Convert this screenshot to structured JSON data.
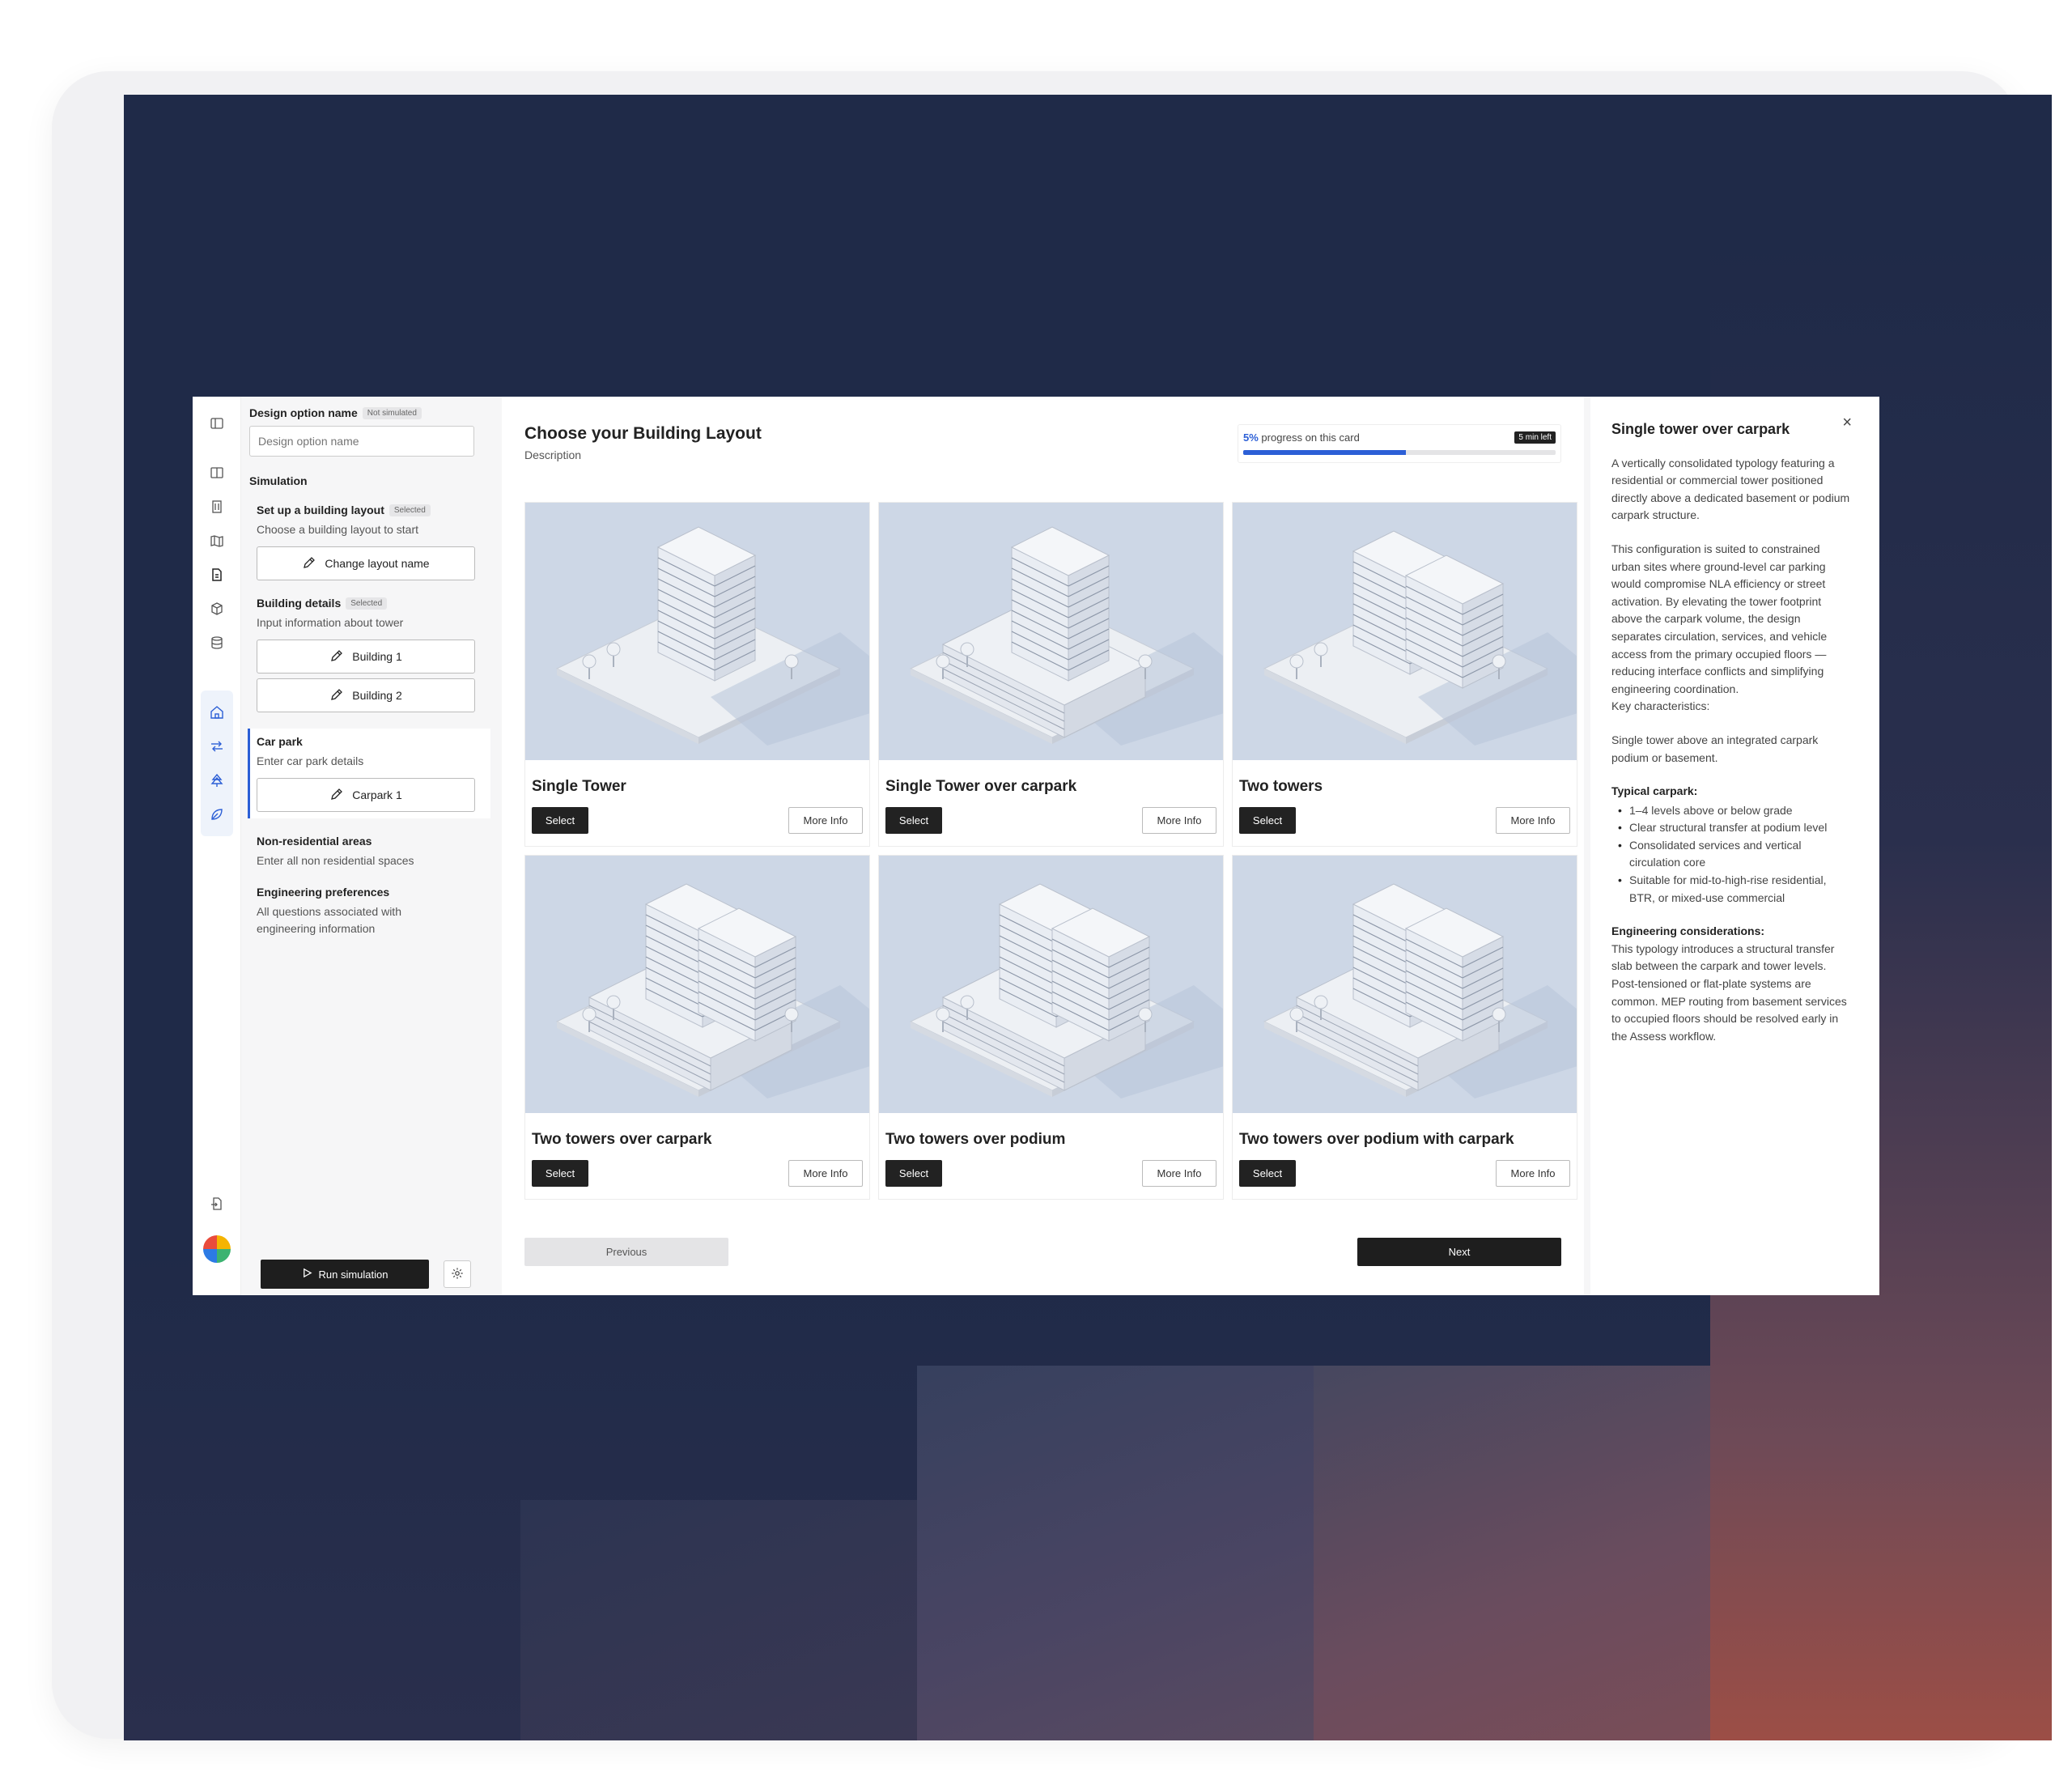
{
  "left_panel": {
    "design_option_label": "Design option name",
    "not_simulated_badge": "Not simulated",
    "design_option_placeholder": "Design option name",
    "simulation_heading": "Simulation",
    "steps": [
      {
        "title": "Set up a building layout",
        "badge": "Selected",
        "desc": "Choose a building layout to start",
        "buttons": [
          "Change layout name"
        ]
      },
      {
        "title": "Building details",
        "badge": "Selected",
        "desc": "Input information about tower",
        "buttons": [
          "Building 1",
          "Building 2"
        ]
      },
      {
        "title": "Car park",
        "desc": "Enter car park details",
        "buttons": [
          "Carpark 1"
        ]
      },
      {
        "title": "Non-residential areas",
        "desc": "Enter all non residential spaces"
      },
      {
        "title": "Engineering preferences",
        "desc": "All questions associated with engineering information"
      }
    ],
    "run_simulation": "Run simulation"
  },
  "main": {
    "title": "Choose your Building Layout",
    "description": "Description",
    "progress_percent_label": "5%",
    "progress_text": "progress on this card",
    "progress_fraction": 0.52,
    "time_left": "5 min left",
    "cards": [
      {
        "title": "Single Tower",
        "select": "Select",
        "more": "More Info"
      },
      {
        "title": "Single Tower over carpark",
        "select": "Select",
        "more": "More Info"
      },
      {
        "title": "Two towers",
        "select": "Select",
        "more": "More Info"
      },
      {
        "title": "Two towers over carpark",
        "select": "Select",
        "more": "More Info"
      },
      {
        "title": "Two towers over podium",
        "select": "Select",
        "more": "More Info"
      },
      {
        "title": "Two towers over podium with carpark",
        "select": "Select",
        "more": "More Info"
      }
    ],
    "previous": "Previous",
    "next": "Next"
  },
  "info_panel": {
    "title": "Single tower over carpark",
    "close": "×",
    "para1": "A vertically consolidated typology featuring a residential or commercial tower positioned directly above a dedicated basement or podium carpark structure.",
    "para2": "This configuration is suited to constrained urban sites where ground-level car parking would compromise NLA efficiency or street activation. By elevating the tower footprint above the carpark volume, the design separates circulation, services, and vehicle access from the primary occupied floors — reducing interface conflicts and simplifying engineering coordination.",
    "key_label": "Key characteristics:",
    "para3": "Single tower above an integrated carpark podium or basement.",
    "typical_head": "Typical carpark:",
    "typical_items": [
      "1–4 levels above or below grade",
      "Clear structural transfer at podium level",
      "Consolidated services and vertical circulation core",
      "Suitable for mid-to-high-rise residential, BTR, or mixed-use commercial"
    ],
    "eng_head": "Engineering considerations:",
    "eng_text": "This typology introduces a structural transfer slab between the carpark and tower levels. Post-tensioned or flat-plate systems are common. MEP routing from basement services to occupied floors should be resolved early in the Assess workflow."
  },
  "colors": {
    "accent": "#2c5fd6",
    "dark": "#1e1e1e",
    "backdrop": "#1f2a48"
  },
  "icons": [
    "sidebar-toggle-icon",
    "panel-icon",
    "building-icon",
    "map-icon",
    "document-icon",
    "cube-icon",
    "database-icon",
    "home-icon",
    "flow-icon",
    "tree-icon",
    "leaf-icon",
    "export-icon",
    "pencil-icon",
    "play-icon",
    "gear-icon",
    "close-icon"
  ]
}
